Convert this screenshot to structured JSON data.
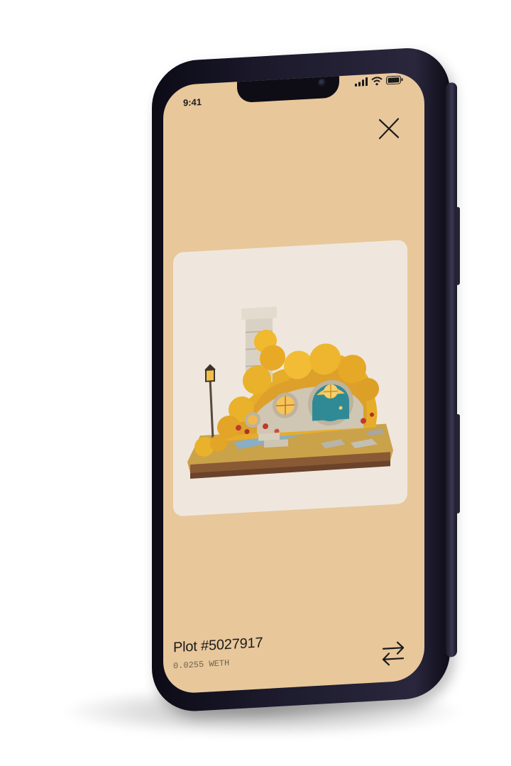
{
  "status_bar": {
    "time": "9:41",
    "icons": [
      "signal-icon",
      "wifi-icon",
      "battery-icon"
    ]
  },
  "header": {
    "close_icon": "close-icon"
  },
  "nft": {
    "title": "Plot #5027917",
    "price": "0.0255 WETH",
    "image": "hobbit-house-illustration"
  },
  "actions": {
    "swap_icon": "swap-arrows-icon"
  },
  "colors": {
    "screen_background": "#e8c79b",
    "card_background": "#efe7de",
    "phone_frame": "#1c1a2c",
    "text_primary": "#1a1a1a",
    "text_secondary": "#6e6352"
  }
}
